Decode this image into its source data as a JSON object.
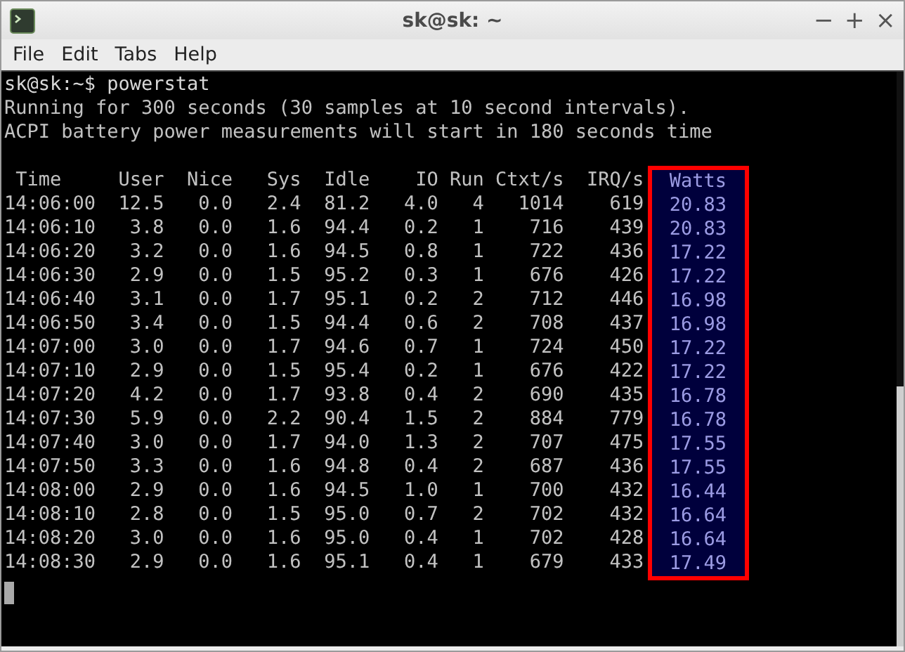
{
  "window": {
    "title": "sk@sk: ~",
    "controls": [
      "−",
      "+",
      "×"
    ]
  },
  "menu": [
    "File",
    "Edit",
    "Tabs",
    "Help"
  ],
  "terminal": {
    "lines": [
      "sk@sk:~$ powerstat",
      "Running for 300 seconds (30 samples at 10 second intervals).",
      "ACPI battery power measurements will start in 180 seconds time"
    ],
    "table": {
      "columns": [
        {
          "label": "Time",
          "highlighted": false
        },
        {
          "label": "User",
          "highlighted": false
        },
        {
          "label": "Nice",
          "highlighted": false
        },
        {
          "label": "Sys",
          "highlighted": false
        },
        {
          "label": "Idle",
          "highlighted": false
        },
        {
          "label": "IO",
          "highlighted": false
        },
        {
          "label": "Run",
          "highlighted": false
        },
        {
          "label": "Ctxt/s",
          "highlighted": false
        },
        {
          "label": "IRQ/s",
          "highlighted": false
        },
        {
          "label": "Watts",
          "highlighted": true
        }
      ],
      "rows": [
        [
          "14:06:00",
          "12.5",
          "0.0",
          "2.4",
          "81.2",
          "4.0",
          "4",
          "1014",
          "619",
          "20.83"
        ],
        [
          "14:06:10",
          "3.8",
          "0.0",
          "1.6",
          "94.4",
          "0.2",
          "1",
          "716",
          "439",
          "20.83"
        ],
        [
          "14:06:20",
          "3.2",
          "0.0",
          "1.6",
          "94.5",
          "0.8",
          "1",
          "722",
          "436",
          "17.22"
        ],
        [
          "14:06:30",
          "2.9",
          "0.0",
          "1.5",
          "95.2",
          "0.3",
          "1",
          "676",
          "426",
          "17.22"
        ],
        [
          "14:06:40",
          "3.1",
          "0.0",
          "1.7",
          "95.1",
          "0.2",
          "2",
          "712",
          "446",
          "16.98"
        ],
        [
          "14:06:50",
          "3.4",
          "0.0",
          "1.5",
          "94.4",
          "0.6",
          "2",
          "708",
          "437",
          "16.98"
        ],
        [
          "14:07:00",
          "3.0",
          "0.0",
          "1.7",
          "94.6",
          "0.7",
          "1",
          "724",
          "450",
          "17.22"
        ],
        [
          "14:07:10",
          "2.9",
          "0.0",
          "1.5",
          "95.4",
          "0.2",
          "1",
          "676",
          "422",
          "17.22"
        ],
        [
          "14:07:20",
          "4.2",
          "0.0",
          "1.7",
          "93.8",
          "0.4",
          "2",
          "690",
          "435",
          "16.78"
        ],
        [
          "14:07:30",
          "5.9",
          "0.0",
          "2.2",
          "90.4",
          "1.5",
          "2",
          "884",
          "779",
          "16.78"
        ],
        [
          "14:07:40",
          "3.0",
          "0.0",
          "1.7",
          "94.0",
          "1.3",
          "2",
          "707",
          "475",
          "17.55"
        ],
        [
          "14:07:50",
          "3.3",
          "0.0",
          "1.6",
          "94.8",
          "0.4",
          "2",
          "687",
          "436",
          "17.55"
        ],
        [
          "14:08:00",
          "2.9",
          "0.0",
          "1.6",
          "94.5",
          "1.0",
          "1",
          "700",
          "432",
          "16.44"
        ],
        [
          "14:08:10",
          "2.8",
          "0.0",
          "1.5",
          "95.0",
          "0.7",
          "2",
          "702",
          "432",
          "16.64"
        ],
        [
          "14:08:20",
          "3.0",
          "0.0",
          "1.6",
          "95.0",
          "0.4",
          "1",
          "702",
          "428",
          "16.64"
        ],
        [
          "14:08:30",
          "2.9",
          "0.0",
          "1.6",
          "95.1",
          "0.4",
          "1",
          "679",
          "433",
          "17.49"
        ]
      ]
    }
  }
}
